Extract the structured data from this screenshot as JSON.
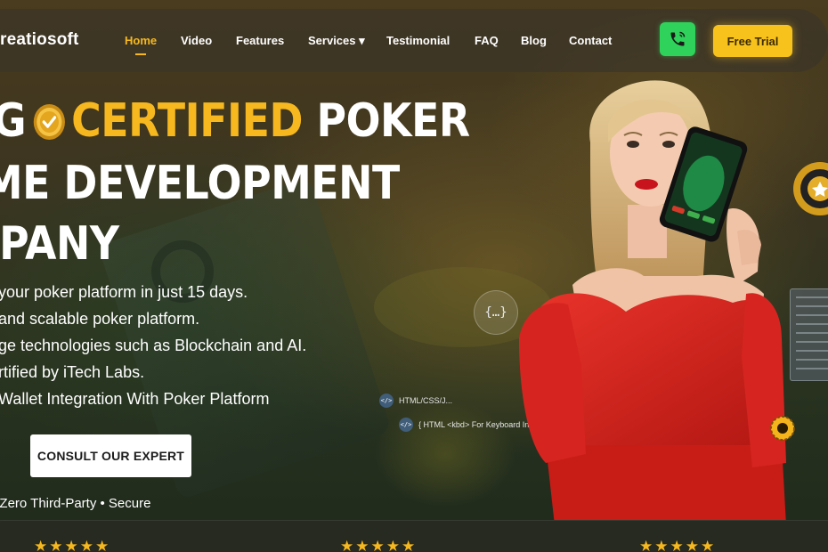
{
  "brand": {
    "logo_text": "reatiosoft"
  },
  "nav": {
    "items": [
      {
        "label": "Home",
        "active": true
      },
      {
        "label": "Video"
      },
      {
        "label": "Features"
      },
      {
        "label": "Services ▾"
      },
      {
        "label": "Testimonial"
      },
      {
        "label": "FAQ"
      },
      {
        "label": "Blog"
      },
      {
        "label": "Contact"
      }
    ],
    "phone_icon": "phone-icon",
    "trial_label": "Free Trial"
  },
  "hero": {
    "line1_pre": "G",
    "line1_cert": "CERTIFIED",
    "line1_post": "POKER",
    "line2": "ME DEVELOPMENT",
    "line3": "MPANY",
    "bullets": [
      " your poker platform in just 15 days.",
      "and scalable poker platform.",
      "ge technologies such as Blockchain and AI.",
      "rtified by iTech Labs.",
      "Wallet Integration With Poker Platform"
    ],
    "cta_label": "CONSULT OUR EXPERT",
    "trust_line": "• Zero Third-Party • Secure"
  },
  "code_float": {
    "circle_label": "{…}",
    "row1_icon": "</>",
    "row1_text": "HTML/CSS/J...",
    "row2_icon": "</>",
    "row2_text": "{ HTML <kbd> For Keyboard In"
  },
  "ratings": {
    "stars": "★★★★★"
  },
  "colors": {
    "accent": "#f6b81e",
    "phone": "#2fd25a",
    "trial": "#f8c21d",
    "dress": "#d9231e"
  }
}
